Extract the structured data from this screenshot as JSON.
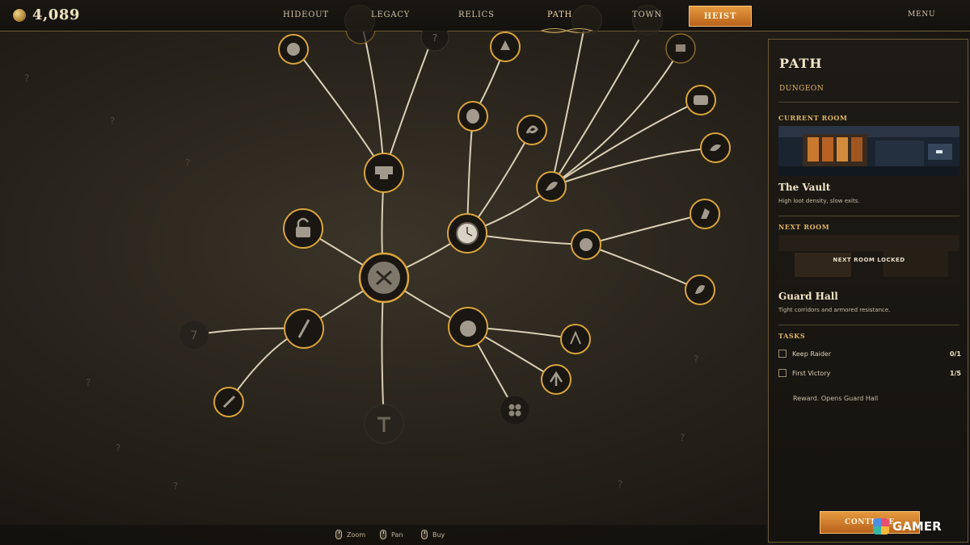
{
  "topbar": {
    "currency_value": "4,089",
    "currency_icon": "gold-coin-icon",
    "nav": {
      "hideout": "HIDEOUT",
      "legacy": "LEGACY",
      "relics": "RELICS",
      "path": "PATH",
      "town": "TOWN",
      "heist": "HEIST",
      "menu": "MENU"
    },
    "active_tab": "PATH",
    "accent_color": "#d17d2c"
  },
  "tree": {
    "unknown_label": "?",
    "locked_number": "7",
    "nodes": [
      {
        "id": "root",
        "icon": "shield-icon",
        "state": "owned"
      },
      {
        "id": "anvil",
        "icon": "anvil-icon",
        "state": "owned"
      },
      {
        "id": "top-left-a",
        "icon": "helmet-icon",
        "state": "owned"
      },
      {
        "id": "top-left-b",
        "icon": "tool-icon",
        "state": "faded"
      },
      {
        "id": "top-left-c",
        "icon": "crossbow-icon",
        "state": "faded"
      },
      {
        "id": "lock",
        "icon": "lock-icon",
        "state": "owned"
      },
      {
        "id": "clock",
        "icon": "clock-icon",
        "state": "owned"
      },
      {
        "id": "barrel",
        "icon": "barrel-icon",
        "state": "owned"
      },
      {
        "id": "gem",
        "icon": "gem-icon",
        "state": "owned"
      },
      {
        "id": "snake",
        "icon": "snake-icon",
        "state": "owned"
      },
      {
        "id": "feather",
        "icon": "feather-icon",
        "state": "owned"
      },
      {
        "id": "chest",
        "icon": "chest-icon",
        "state": "faded"
      },
      {
        "id": "drum",
        "icon": "drum-icon",
        "state": "owned"
      },
      {
        "id": "bird",
        "icon": "bird-icon",
        "state": "owned"
      },
      {
        "id": "helm2",
        "icon": "helm-icon",
        "state": "owned"
      },
      {
        "id": "horse",
        "icon": "horse-icon",
        "state": "owned"
      },
      {
        "id": "rooster",
        "icon": "rooster-icon",
        "state": "owned"
      },
      {
        "id": "spear",
        "icon": "spear-icon",
        "state": "owned"
      },
      {
        "id": "dagger",
        "icon": "dagger-icon",
        "state": "owned"
      },
      {
        "id": "locked7",
        "icon": "locked-icon",
        "state": "locked"
      },
      {
        "id": "hammer",
        "icon": "hammer-icon",
        "state": "locked"
      },
      {
        "id": "bomb",
        "icon": "bomb-icon",
        "state": "owned"
      },
      {
        "id": "campfire",
        "icon": "campfire-icon",
        "state": "owned"
      },
      {
        "id": "arrow-up",
        "icon": "arrow-up-icon",
        "state": "owned"
      },
      {
        "id": "clover",
        "icon": "clover-icon",
        "state": "dark"
      }
    ]
  },
  "panel": {
    "title": "PATH",
    "subtitle": "DUNGEON",
    "current_room_label": "CURRENT ROOM",
    "current_room_name": "The Vault",
    "current_room_desc": "High loot density, slow exits.",
    "next_room_label": "NEXT ROOM",
    "next_room_locked_text": "NEXT ROOM LOCKED",
    "next_room_name": "Guard Hall",
    "next_room_desc": "Tight corridors and armored resistance.",
    "tasks_label": "TASKS",
    "tasks": [
      {
        "label": "Keep Raider",
        "count": "0/1",
        "checked": false
      },
      {
        "label": "First Victory",
        "count": "1/5",
        "checked": false
      }
    ],
    "reward_text": "Reward. Opens Guard Hall",
    "continue_label": "CONTINUE"
  },
  "hints": {
    "zoom": "Zoom",
    "pan": "Pan",
    "buy": "Buy"
  },
  "watermark": "GAMER"
}
